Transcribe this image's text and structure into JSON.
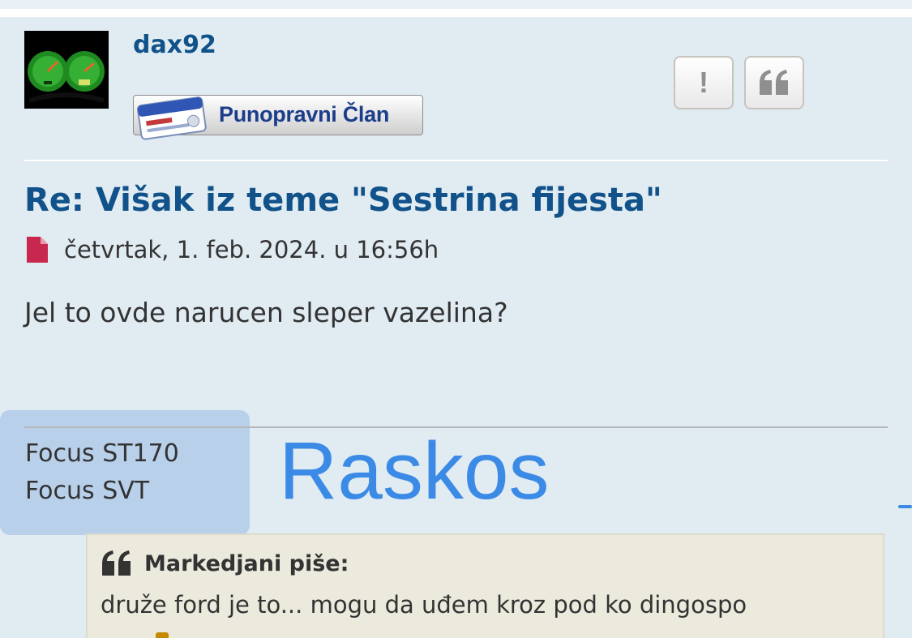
{
  "post": {
    "author": "dax92",
    "rank_label": "Punopravni Član",
    "title": "Re: Višak iz teme \"Sestrina fijesta\"",
    "date": "četvrtak, 1. feb. 2024. u 16:56h",
    "content": "Jel to ovde narucen sleper vazelina?",
    "buttons": {
      "report_label": "!",
      "report_icon": "exclamation-icon",
      "quote_icon": "quote-icon"
    },
    "date_icon": "document-icon"
  },
  "signature": {
    "line1": "Focus ST170",
    "line2": "Focus SVT",
    "name": "Raskos"
  },
  "quote": {
    "author_line": "Markedjani piše:",
    "text": "druže ford je to... mogu da uđem kroz pod ko dingospo",
    "icon": "quote-icon"
  },
  "colors": {
    "post_bg": "#e1ebf2",
    "link": "#105289",
    "signature_bg": "#b8d0ea",
    "signature_name": "#3b8be6",
    "quote_bg": "#ebeadd",
    "date_icon": "#c8284e"
  }
}
